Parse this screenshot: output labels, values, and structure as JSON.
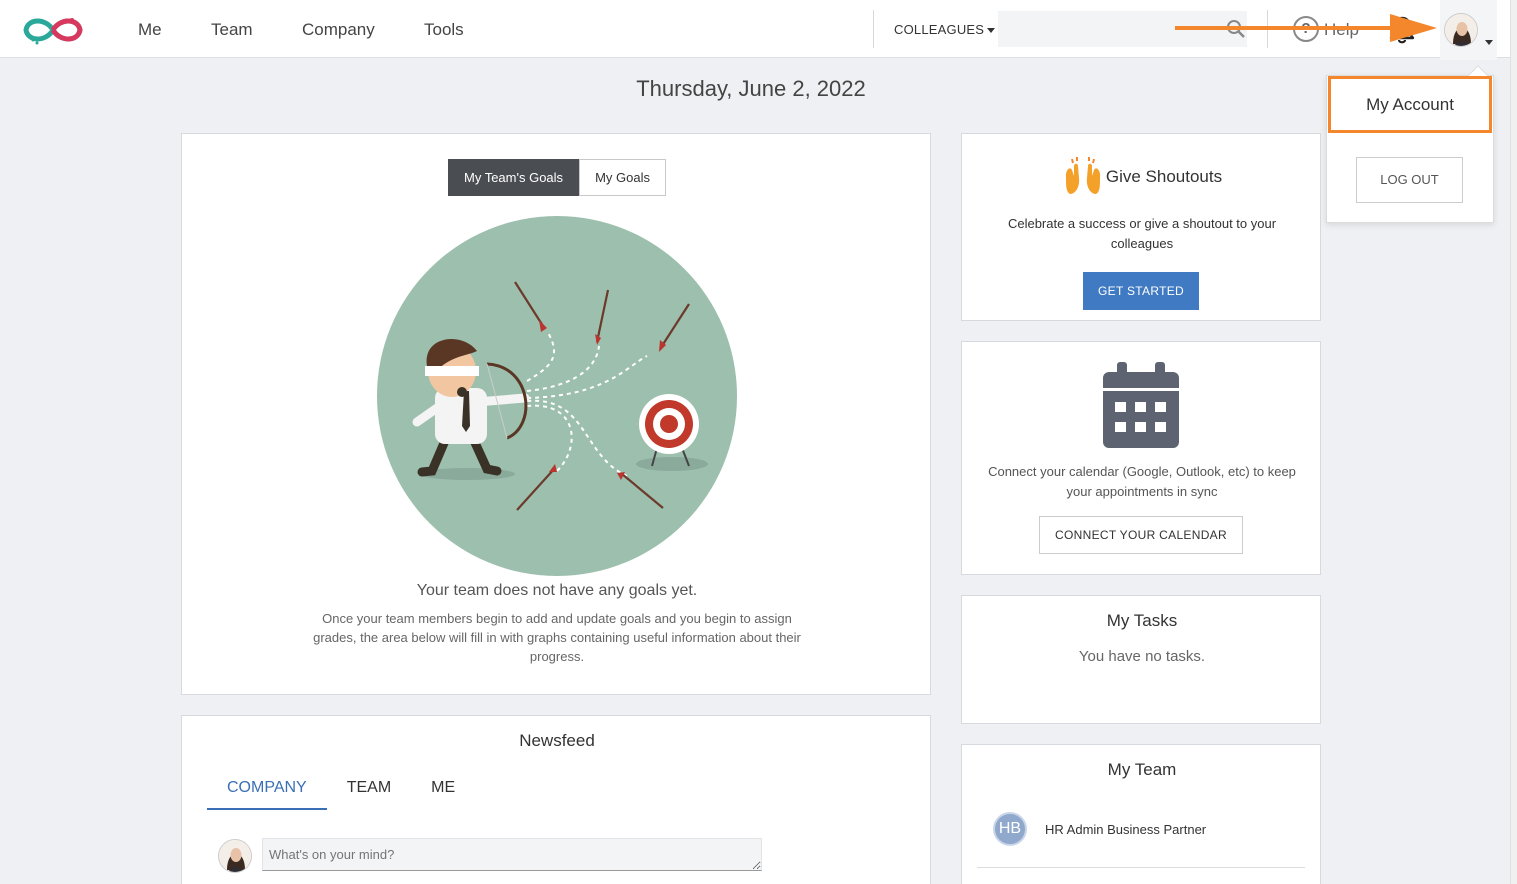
{
  "nav": {
    "items": [
      "Me",
      "Team",
      "Company",
      "Tools"
    ],
    "colleagues_label": "COLLEAGUES",
    "search_placeholder": "",
    "help_label": "Help"
  },
  "account_menu": {
    "my_account": "My Account",
    "logout": "LOG OUT"
  },
  "date": "Thursday, June 2, 2022",
  "goals": {
    "tabs": [
      "My Team's Goals",
      "My Goals"
    ],
    "active_tab": 0,
    "empty_title": "Your team does not have any goals yet.",
    "empty_text": "Once your team members begin to add and update goals and you begin to assign grades, the area below will fill in with graphs containing useful information about their progress."
  },
  "newsfeed": {
    "title": "Newsfeed",
    "tabs": [
      "COMPANY",
      "TEAM",
      "ME"
    ],
    "active_tab": 0,
    "post_placeholder": "What's on your mind?"
  },
  "shoutouts": {
    "title": "Give Shoutouts",
    "text": "Celebrate a success or give a shoutout to your colleagues",
    "button": "GET STARTED"
  },
  "calendar": {
    "text": "Connect your calendar (Google, Outlook, etc) to keep your appointments in sync",
    "button": "CONNECT YOUR CALENDAR"
  },
  "tasks": {
    "title": "My Tasks",
    "empty": "You have no tasks."
  },
  "team": {
    "title": "My Team",
    "members": [
      {
        "initials": "HB",
        "name": "HR Admin Business Partner"
      }
    ]
  },
  "colors": {
    "accent": "#3f7ac2",
    "highlight": "#f4862c",
    "illustration_bg": "#9dbfae"
  }
}
